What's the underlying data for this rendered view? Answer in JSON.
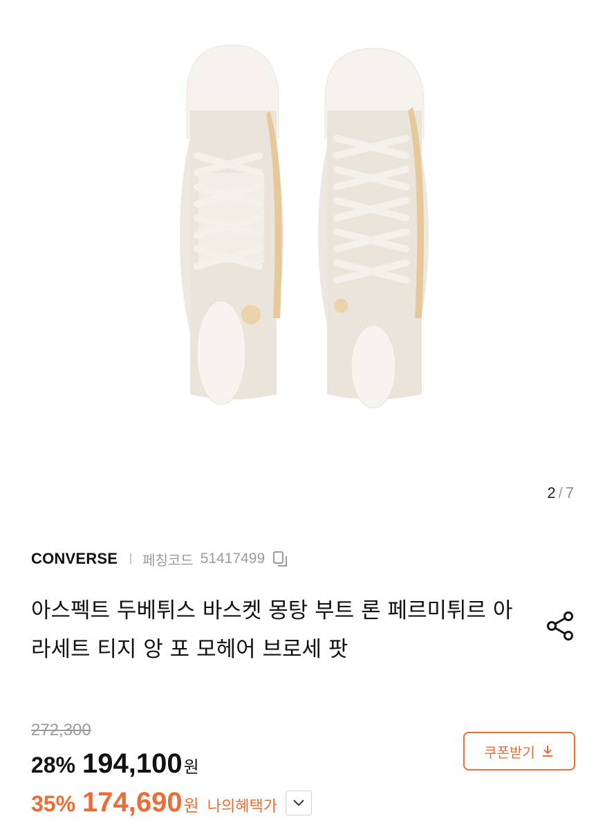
{
  "gallery": {
    "image_alt": "Converse high-top sneakers, top view",
    "current_page": "2",
    "separator": "/",
    "total_pages": "7"
  },
  "product": {
    "brand": "CONVERSE",
    "code_label": "페칭코드",
    "code_value": "51417499",
    "title": "아스펙트 두베튀스 바스켓 몽탕 부트 론 페르미튀르 아 라세트 티지 앙 포 모헤어 브로세 팟"
  },
  "pricing": {
    "original_price": "272,300",
    "sale": {
      "percent": "28%",
      "amount": "194,100",
      "currency": "원"
    },
    "my_benefit": {
      "percent": "35%",
      "amount": "174,690",
      "currency": "원",
      "label": "나의혜택가"
    },
    "coupon_label": "쿠폰받기"
  },
  "colors": {
    "accent": "#ef6b35",
    "muted": "#9a9a9a"
  },
  "icons": {
    "copy": "copy-icon",
    "share": "share-icon",
    "download": "download-icon",
    "chevron": "chevron-down-icon"
  }
}
